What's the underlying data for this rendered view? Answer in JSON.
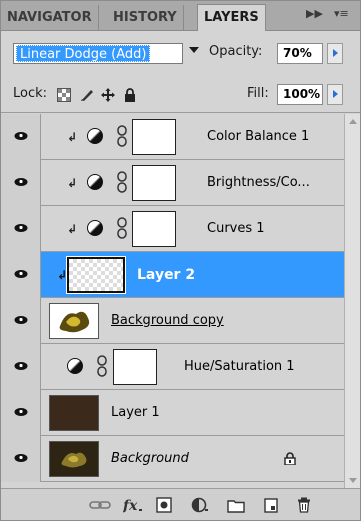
{
  "tabs": [
    {
      "label": "NAVIGATOR",
      "active": false
    },
    {
      "label": "HISTORY",
      "active": false
    },
    {
      "label": "LAYERS",
      "active": true
    }
  ],
  "tab_controls": {
    "collapse": "▶▶",
    "menu": "▾≡"
  },
  "blend": {
    "mode": "Linear Dodge (Add)",
    "opacity_label": "Opacity:",
    "opacity_value": "70%"
  },
  "lock": {
    "label": "Lock:",
    "fill_label": "Fill:",
    "fill_value": "100%"
  },
  "layers": [
    {
      "name": "Color Balance 1",
      "type": "adjustment",
      "clipped": true
    },
    {
      "name": "Brightness/Co...",
      "type": "adjustment",
      "clipped": true
    },
    {
      "name": "Curves 1",
      "type": "adjustment",
      "clipped": true
    },
    {
      "name": "Layer 2",
      "type": "pixel",
      "clipped": true,
      "selected": true
    },
    {
      "name": "Background copy",
      "type": "pixel",
      "style": "underline"
    },
    {
      "name": "Hue/Saturation 1",
      "type": "adjustment",
      "clipped": false
    },
    {
      "name": "Layer 1",
      "type": "pixel"
    },
    {
      "name": "Background",
      "type": "background",
      "style": "italic",
      "locked": true
    }
  ],
  "toolbar_icons": [
    "link-layers-icon",
    "fx-icon",
    "add-mask-icon",
    "new-adjustment-icon",
    "new-group-icon",
    "new-layer-icon",
    "trash-icon"
  ],
  "colors": {
    "selection": "#3399ff",
    "panel": "#d4d4d4"
  }
}
